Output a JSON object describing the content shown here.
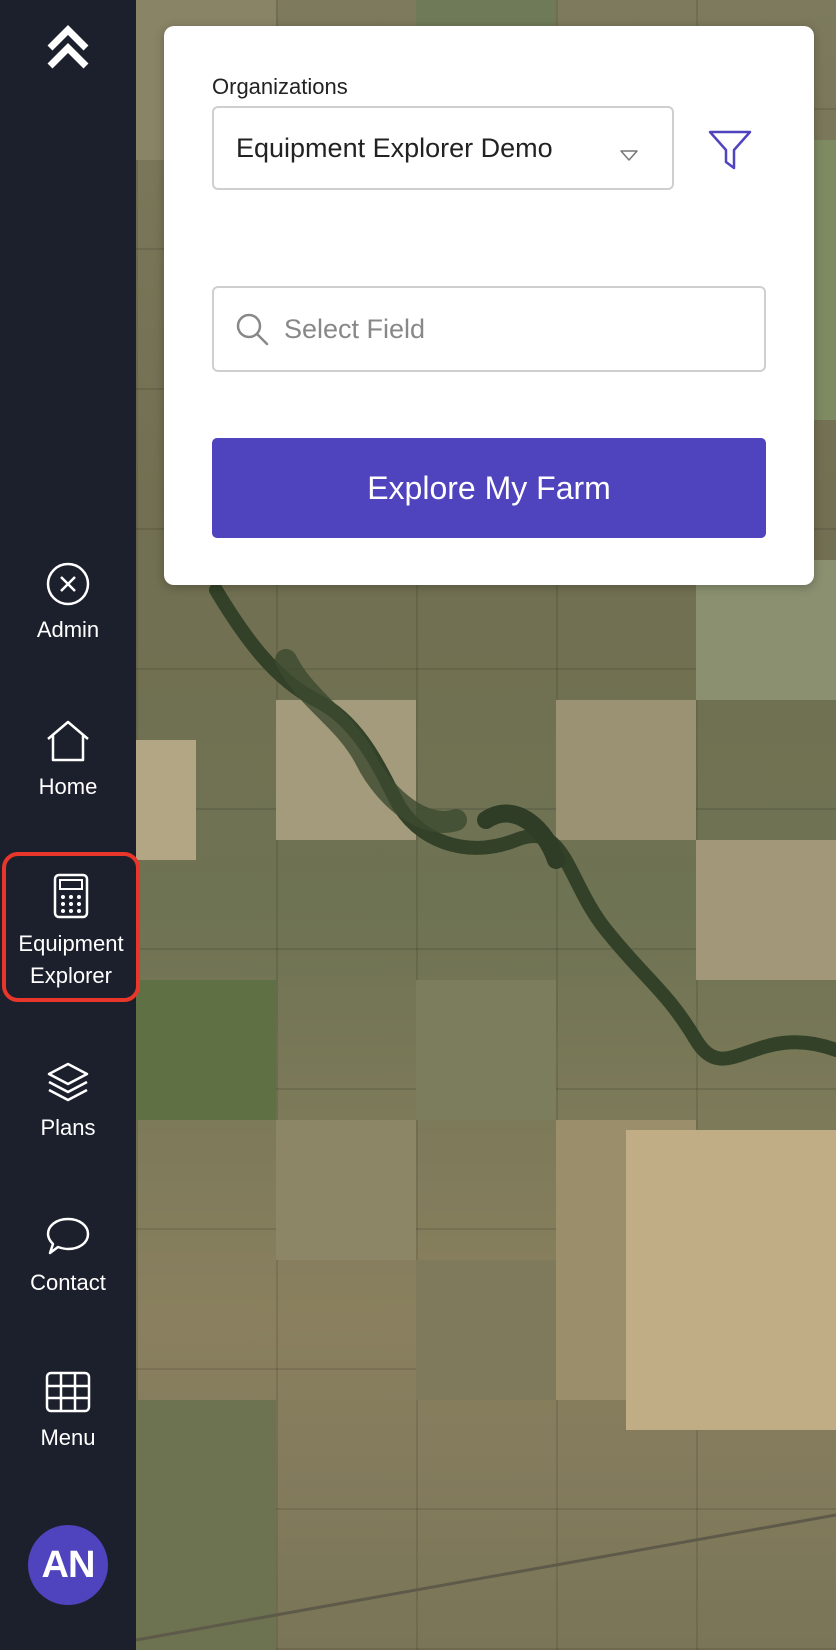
{
  "sidebar": {
    "items": [
      {
        "label": "Admin",
        "icon": "close-circle-icon"
      },
      {
        "label": "Home",
        "icon": "home-icon"
      },
      {
        "label": "Equipment Explorer",
        "icon": "calculator-icon",
        "active": true
      },
      {
        "label": "Plans",
        "icon": "layers-icon"
      },
      {
        "label": "Contact",
        "icon": "chat-bubble-icon"
      },
      {
        "label": "Menu",
        "icon": "grid-icon"
      }
    ],
    "avatar_initials": "AN"
  },
  "panel": {
    "org_label": "Organizations",
    "org_value": "Equipment Explorer Demo",
    "field_placeholder": "Select Field",
    "explore_button": "Explore My Farm"
  },
  "colors": {
    "sidebar_bg": "#1c202c",
    "accent": "#5043be",
    "active_outline": "#e8372a"
  }
}
